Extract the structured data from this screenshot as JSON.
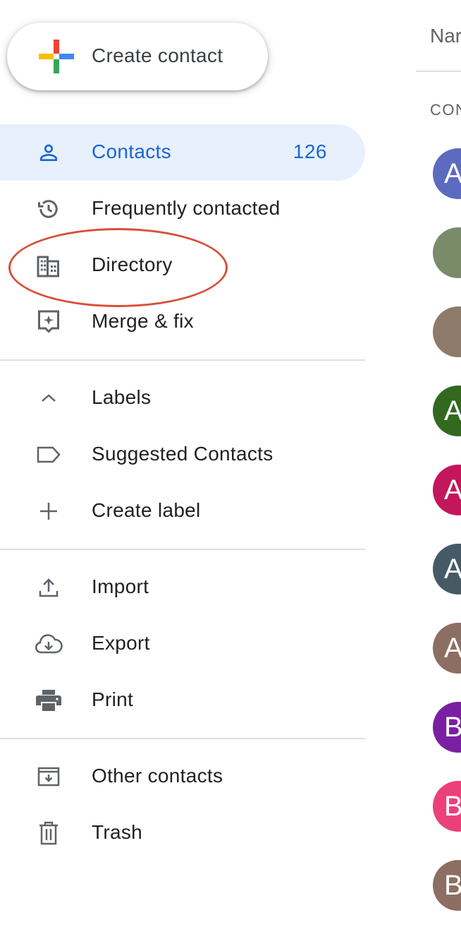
{
  "create_button": {
    "label": "Create contact"
  },
  "nav": {
    "contacts": {
      "label": "Contacts",
      "count": "126"
    },
    "frequently_contacted": {
      "label": "Frequently contacted"
    },
    "directory": {
      "label": "Directory"
    },
    "merge_fix": {
      "label": "Merge & fix"
    },
    "labels": {
      "label": "Labels"
    },
    "suggested_contacts": {
      "label": "Suggested Contacts"
    },
    "create_label": {
      "label": "Create label"
    },
    "import": {
      "label": "Import"
    },
    "export": {
      "label": "Export"
    },
    "print": {
      "label": "Print"
    },
    "other_contacts": {
      "label": "Other contacts"
    },
    "trash": {
      "label": "Trash"
    }
  },
  "list": {
    "column_header": "Nar",
    "section_label": "CON",
    "avatars": [
      {
        "letter": "A",
        "color": "#5c6bc0"
      },
      {
        "letter": "",
        "color": "#7a8b6a"
      },
      {
        "letter": "",
        "color": "#8d7a6a"
      },
      {
        "letter": "A",
        "color": "#33691e"
      },
      {
        "letter": "A",
        "color": "#c2185b"
      },
      {
        "letter": "A",
        "color": "#455a64"
      },
      {
        "letter": "A",
        "color": "#8d6e63"
      },
      {
        "letter": "B",
        "color": "#7b1fa2"
      },
      {
        "letter": "B",
        "color": "#ec407a"
      },
      {
        "letter": "B",
        "color": "#8d6e63"
      }
    ]
  },
  "colors": {
    "accent": "#1967d2",
    "active_bg": "#e8f0fe",
    "highlight": "#d94f3a"
  }
}
